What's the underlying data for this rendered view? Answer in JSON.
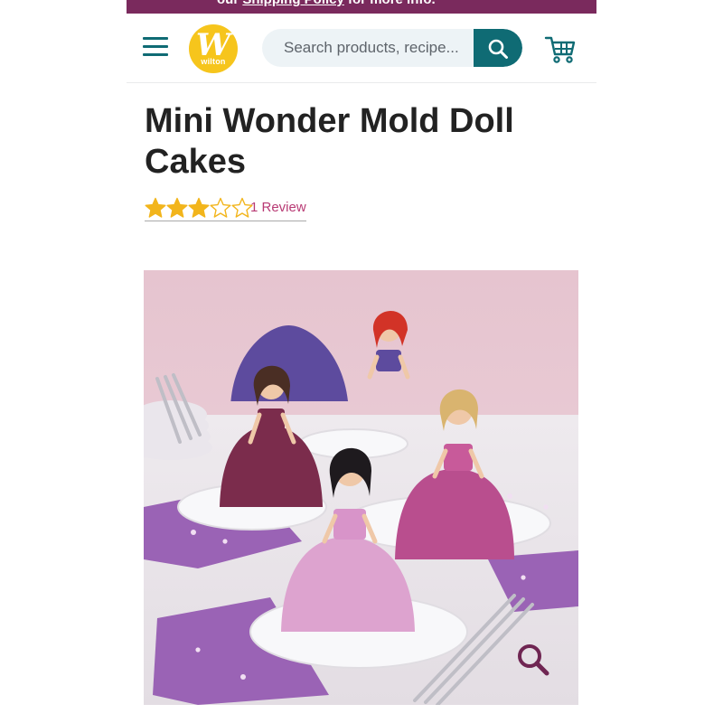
{
  "promo": {
    "prefix": "our ",
    "link_text": "Shipping Policy",
    "suffix": " for more info."
  },
  "header": {
    "logo_text": "wilton",
    "logo_letter": "W",
    "search": {
      "placeholder": "Search products, recipe..."
    }
  },
  "product": {
    "title": "Mini Wonder Mold Doll Cakes",
    "rating": 3,
    "rating_max": 5,
    "review_text": "1 Review"
  },
  "colors": {
    "brand_teal": "#0f6b74",
    "promo_purple": "#7a2a5d",
    "star_gold": "#f2b51c",
    "review_pink": "#b83a74",
    "logo_yellow": "#f6c51c"
  },
  "icons": [
    "menu-icon",
    "search-icon",
    "cart-icon",
    "star-icon",
    "zoom-icon"
  ]
}
